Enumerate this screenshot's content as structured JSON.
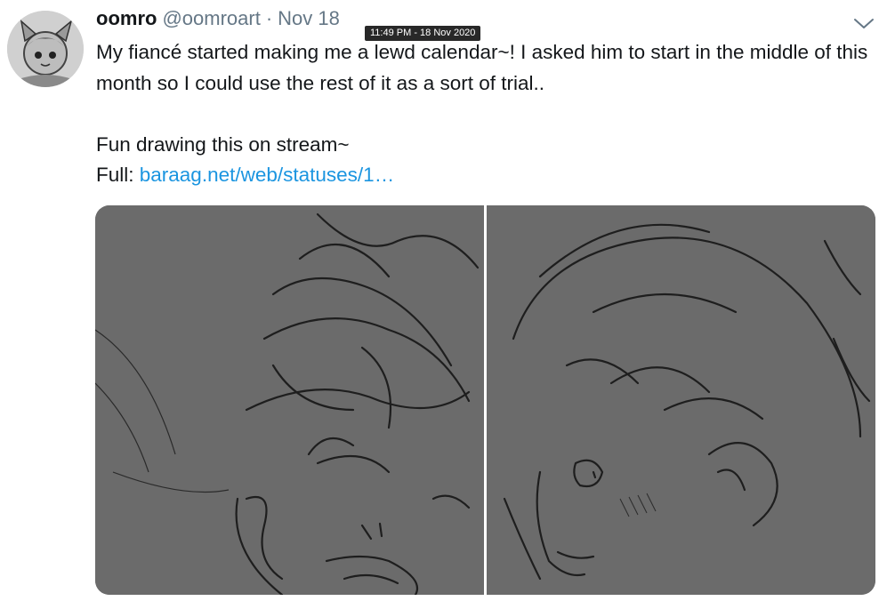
{
  "tweet": {
    "display_name": "oomro",
    "handle": "@oomroart",
    "separator": "·",
    "date": "Nov 18",
    "tooltip": "11:49 PM - 18 Nov 2020",
    "text_line1": "My fiancé started making me a lewd calendar~! I asked him to start in the middle of this month so I could use the rest of it as a sort of trial..",
    "text_line2": "Fun drawing this on stream~",
    "full_label": "Full: ",
    "full_link": "baraag.net/web/statuses/1…",
    "icons": {
      "avatar": "avatar-image",
      "menu": "chevron-down-icon"
    },
    "colors": {
      "link": "#1b95e0",
      "muted": "#657786",
      "image_bg": "#6b6b6b"
    }
  }
}
